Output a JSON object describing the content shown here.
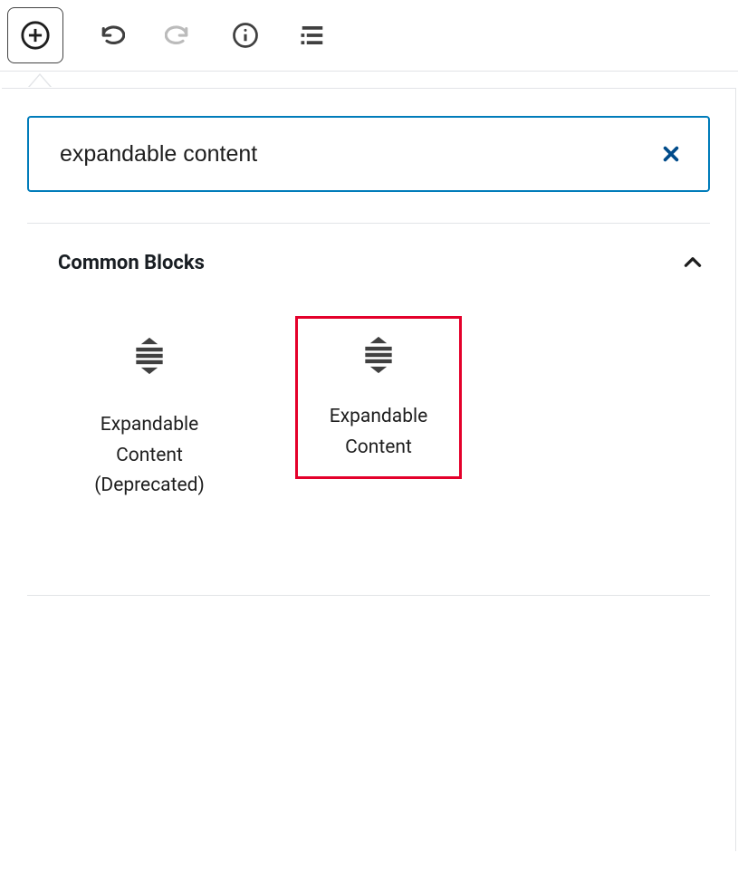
{
  "search": {
    "value": "expandable content"
  },
  "section": {
    "title": "Common Blocks",
    "blocks": [
      {
        "label": "Expandable Content (Deprecated)"
      },
      {
        "label": "Expandable Content"
      }
    ]
  }
}
